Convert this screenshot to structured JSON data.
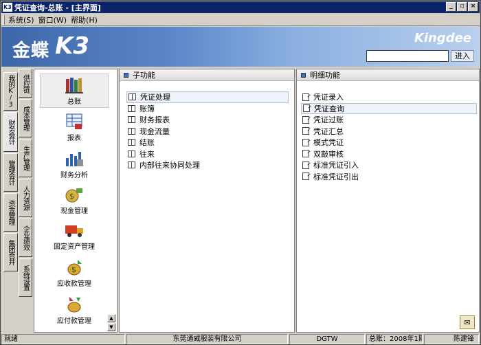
{
  "window": {
    "title": "凭证查询-总账 - [主界面]",
    "app_icon": "K3",
    "minimize_icon": "_",
    "restore_icon": "▫",
    "close_icon": "×"
  },
  "menu": [
    {
      "label": "系统(S)"
    },
    {
      "label": "窗口(W)"
    },
    {
      "label": "帮助(H)"
    }
  ],
  "banner": {
    "logo_cn": "金蝶",
    "logo_k3": "K3",
    "brand": "Kingdee",
    "search_value": "",
    "go_label": "进入"
  },
  "outer_tabs": [
    {
      "label": "我的K/3"
    },
    {
      "label": "财务会计"
    },
    {
      "label": "管理会计"
    },
    {
      "label": "资金管理"
    },
    {
      "label": "集团合并"
    }
  ],
  "inner_tabs": [
    {
      "label": "供应链"
    },
    {
      "label": "成本管理"
    },
    {
      "label": "生产管理"
    },
    {
      "label": "人力资源"
    },
    {
      "label": "企业绩效"
    },
    {
      "label": "系统设置"
    }
  ],
  "modules": [
    {
      "label": "总账",
      "icon": "books-icon"
    },
    {
      "label": "报表",
      "icon": "report-icon"
    },
    {
      "label": "财务分析",
      "icon": "analysis-icon"
    },
    {
      "label": "现金管理",
      "icon": "cash-icon"
    },
    {
      "label": "固定资产管理",
      "icon": "truck-icon"
    },
    {
      "label": "应收款管理",
      "icon": "receivable-icon"
    },
    {
      "label": "应付款管理",
      "icon": "payable-icon"
    }
  ],
  "sub_panel": {
    "title": "子功能",
    "items": [
      {
        "label": "凭证处理"
      },
      {
        "label": "账簿"
      },
      {
        "label": "财务报表"
      },
      {
        "label": "现金流量"
      },
      {
        "label": "结账"
      },
      {
        "label": "往来"
      },
      {
        "label": "内部往来协同处理"
      }
    ]
  },
  "detail_panel": {
    "title": "明细功能",
    "items": [
      {
        "label": "凭证录入"
      },
      {
        "label": "凭证查询"
      },
      {
        "label": "凭证过账"
      },
      {
        "label": "凭证汇总"
      },
      {
        "label": "模式凭证"
      },
      {
        "label": "双敲审核"
      },
      {
        "label": "标准凭证引入"
      },
      {
        "label": "标准凭证引出"
      }
    ]
  },
  "status": {
    "state": "就绪",
    "company": "东莞通威服装有限公司",
    "account": "DGTW",
    "period": "总账：2008年1期",
    "user": "陈建锋"
  },
  "colors": {
    "title_bar": "#0a246a",
    "banner_start": "#3c66a8",
    "banner_end": "#b9d0ee",
    "face": "#d4d0c8"
  }
}
